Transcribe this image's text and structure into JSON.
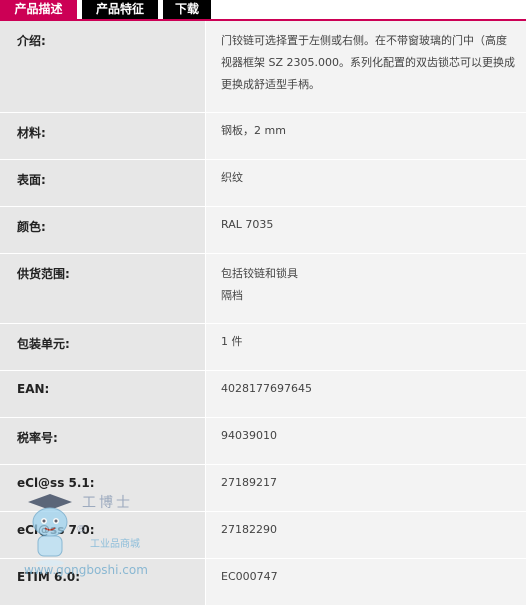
{
  "tabs": [
    {
      "label": "产品描述",
      "active": true
    },
    {
      "label": "产品特征",
      "active": false
    },
    {
      "label": "下载",
      "active": false
    }
  ],
  "colors": {
    "accent": "#cc0055",
    "tab_inactive": "#000000",
    "label_bg": "#e7e7e7",
    "value_bg": "#f3f3f3"
  },
  "specs": [
    {
      "label": "介绍:",
      "lines": [
        "门铰链可选择置于左侧或右侧。在不带窗玻璃的门中（高度",
        "视器框架 SZ 2305.000。系列化配置的双齿锁芯可以更换成",
        "更换成舒适型手柄。"
      ]
    },
    {
      "label": "材料:",
      "lines": [
        "钢板，2 mm"
      ]
    },
    {
      "label": "表面:",
      "lines": [
        "织纹"
      ]
    },
    {
      "label": "颜色:",
      "lines": [
        "RAL 7035"
      ]
    },
    {
      "label": "供货范围:",
      "lines": [
        "包括铰链和锁具",
        "隔档"
      ]
    },
    {
      "label": "包装单元:",
      "lines": [
        "1 件"
      ]
    },
    {
      "label": "EAN:",
      "lines": [
        "4028177697645"
      ]
    },
    {
      "label": "税率号:",
      "lines": [
        "94039010"
      ]
    },
    {
      "label": "eCl@ss 5.1:",
      "lines": [
        "27189217"
      ]
    },
    {
      "label": "eCl@ss 7.0:",
      "lines": [
        "27182290"
      ]
    },
    {
      "label": "ETIM 6.0:",
      "lines": [
        "EC000747"
      ]
    }
  ],
  "watermark": {
    "brand": "工博士",
    "tagline": "工业品商城",
    "url": "www.gongboshi.com",
    "registered": "®",
    "icon": "robot-mascot-icon"
  }
}
